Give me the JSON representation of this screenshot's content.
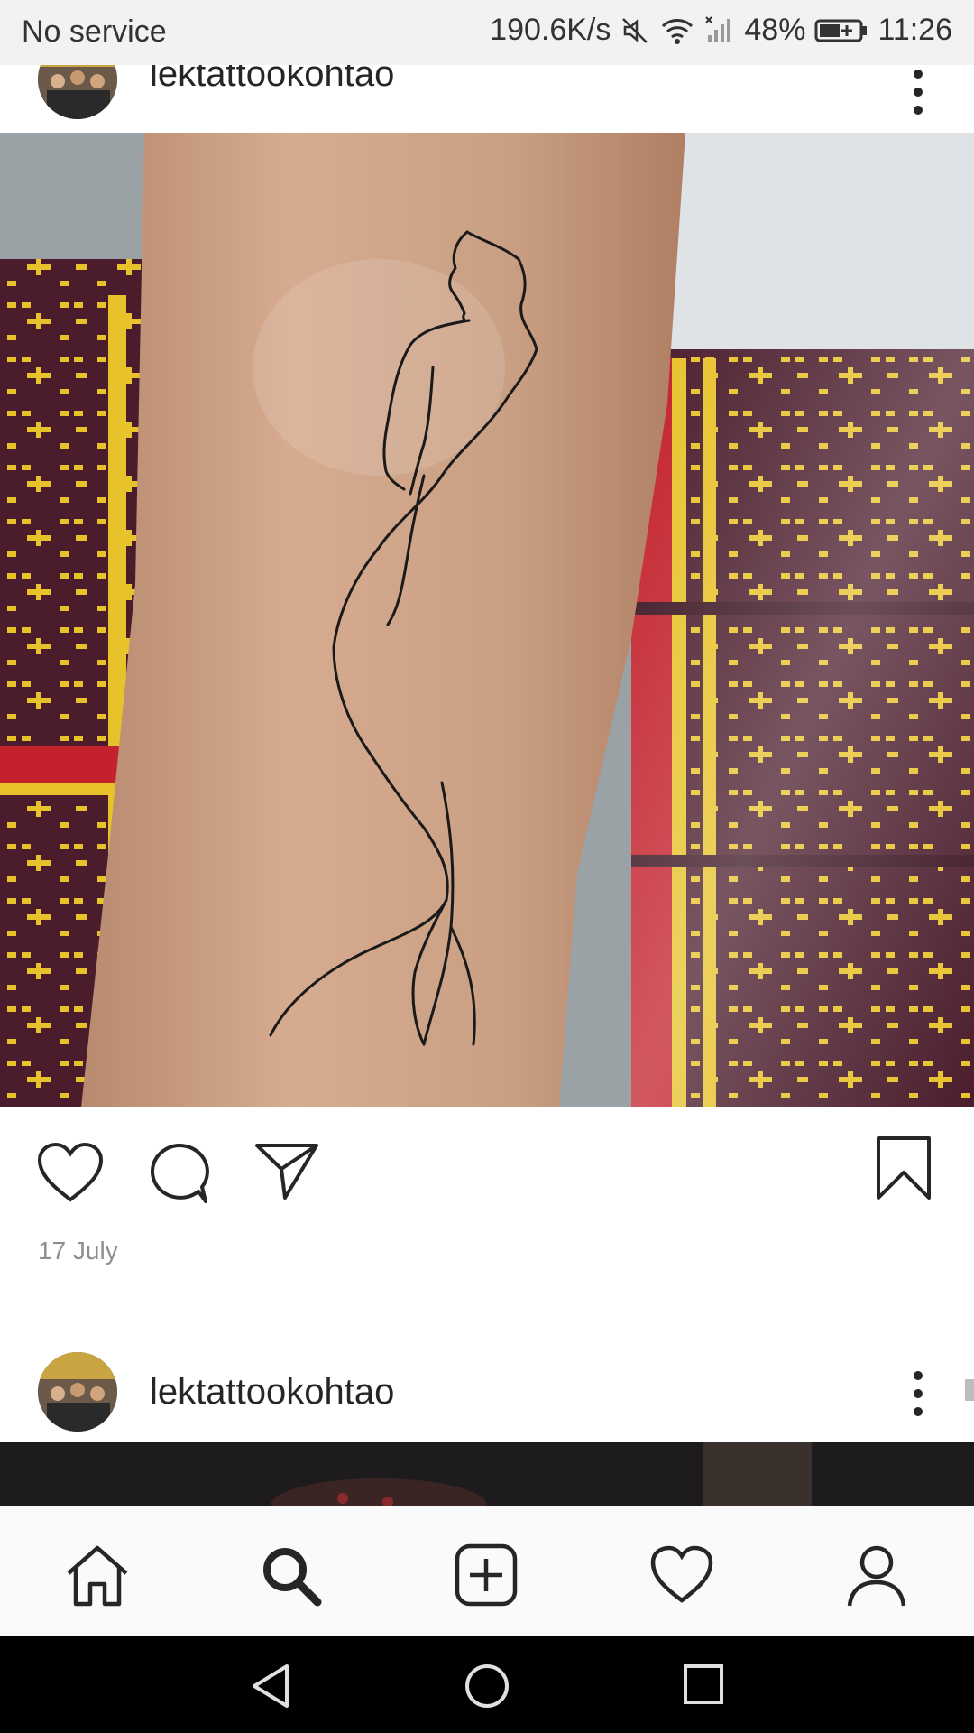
{
  "status_bar": {
    "carrier": "No service",
    "speed": "190.6K/s",
    "battery": "48%",
    "time": "11:26",
    "icons": [
      "mute-icon",
      "wifi-icon",
      "signal-icon",
      "battery-icon"
    ]
  },
  "post1": {
    "username": "lektattookohtao",
    "image_description": "",
    "date": "17 July"
  },
  "post2": {
    "username": "lektattookohtao"
  },
  "bottom_nav": {
    "items": [
      "home-icon",
      "search-icon",
      "add-post-icon",
      "activity-heart-icon",
      "profile-icon"
    ]
  },
  "system_nav": [
    "back-icon",
    "home-circle-icon",
    "recents-icon"
  ],
  "colors": {
    "text": "#262626",
    "muted": "#8e8e8e",
    "fabric_purple": "#4b1d2c",
    "fabric_yellow": "#e7c22a",
    "fabric_red": "#c3212b",
    "skin": "#c99a7c"
  }
}
